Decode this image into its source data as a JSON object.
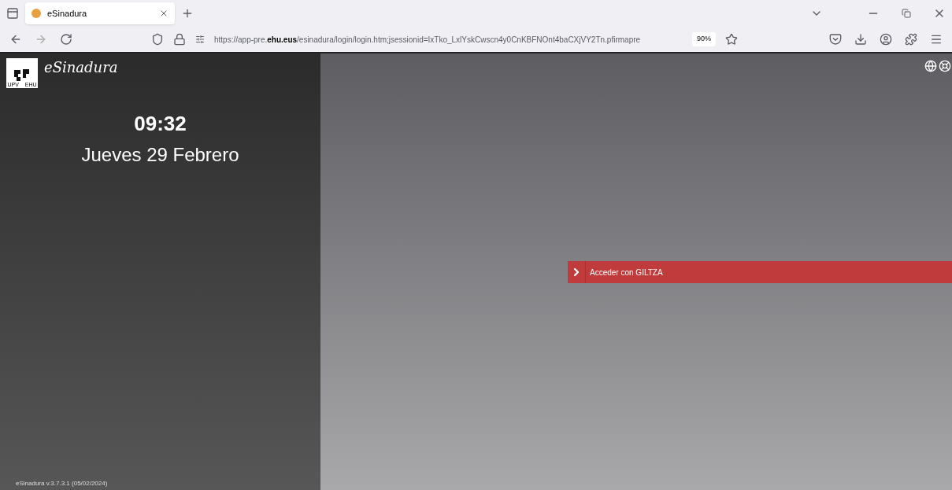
{
  "browser": {
    "tab": {
      "title": "eSinadura",
      "selected": true
    },
    "url": "https://app-pre.**ehu.eus**/esinadura/login/login.htm;jsessionid=IxTko_LxlYskCwscn4y0CnKBFNOnt4baCXjVY2Tn.pfirmapre",
    "zoom": "90%"
  },
  "sidebar": {
    "logo_text": [
      "UPV",
      "EHU"
    ],
    "app_name": "eSinadura",
    "time": "09:32",
    "date": "Jueves 29 Febrero",
    "version": "eSinadura v.3.7.3.1 (05/02/2024)"
  },
  "login": {
    "button": "Acceder con GILTZA"
  }
}
